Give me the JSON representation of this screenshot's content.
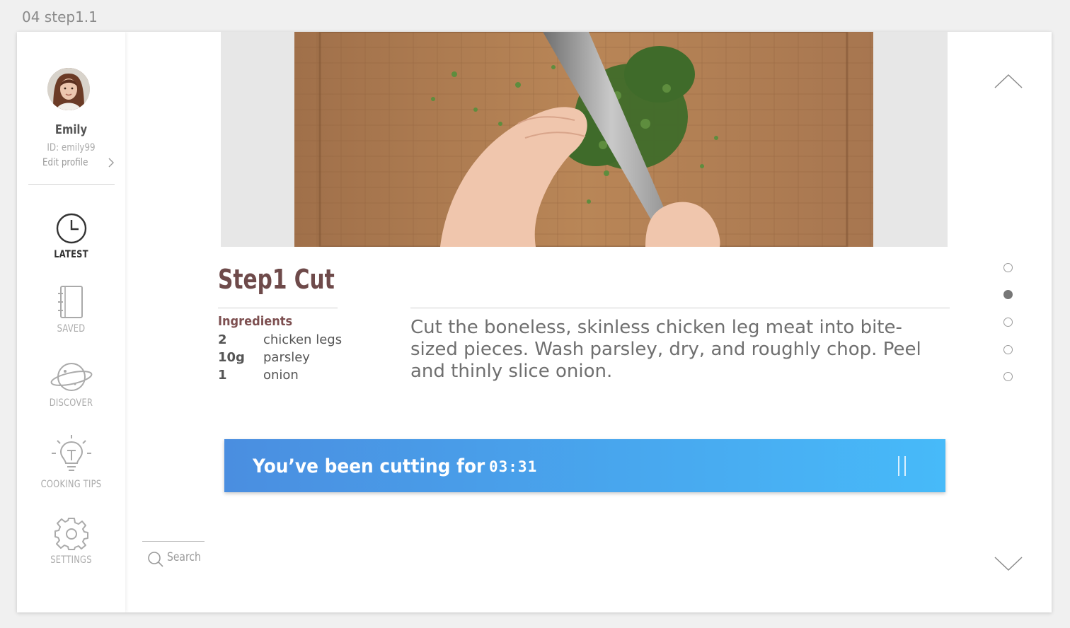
{
  "artboard": {
    "label": "04 step1.1"
  },
  "profile": {
    "name": "Emily",
    "id": "ID: emily99",
    "edit_label": "Edit profile"
  },
  "nav": {
    "items": [
      {
        "label": "LATEST",
        "icon": "clock-icon",
        "active": true
      },
      {
        "label": "SAVED",
        "icon": "notebook-icon",
        "active": false
      },
      {
        "label": "DISCOVER",
        "icon": "planet-icon",
        "active": false
      },
      {
        "label": "COOKING TIPS",
        "icon": "lightbulb-icon",
        "active": false
      },
      {
        "label": "SETTINGS",
        "icon": "gear-icon",
        "active": false
      }
    ]
  },
  "search": {
    "label": "Search"
  },
  "step": {
    "title": "Step1 Cut",
    "ingredients_heading": "Ingredients",
    "ingredients": [
      {
        "qty": "2",
        "name": "chicken legs"
      },
      {
        "qty": "10g",
        "name": "parsley"
      },
      {
        "qty": "1",
        "name": "onion"
      }
    ],
    "description": "Cut the boneless, skinless chicken leg meat into bite-sized pieces. Wash parsley, dry, and roughly chop. Peel and thinly slice onion."
  },
  "timer": {
    "label": "You’ve been cutting for",
    "value": "03:31"
  },
  "pager": {
    "total": 5,
    "current": 2
  },
  "colors": {
    "accent_start": "#4a8ee0",
    "accent_end": "#47baf9",
    "title": "#6e4a4a",
    "ingredient_heading": "#7d4f50"
  }
}
